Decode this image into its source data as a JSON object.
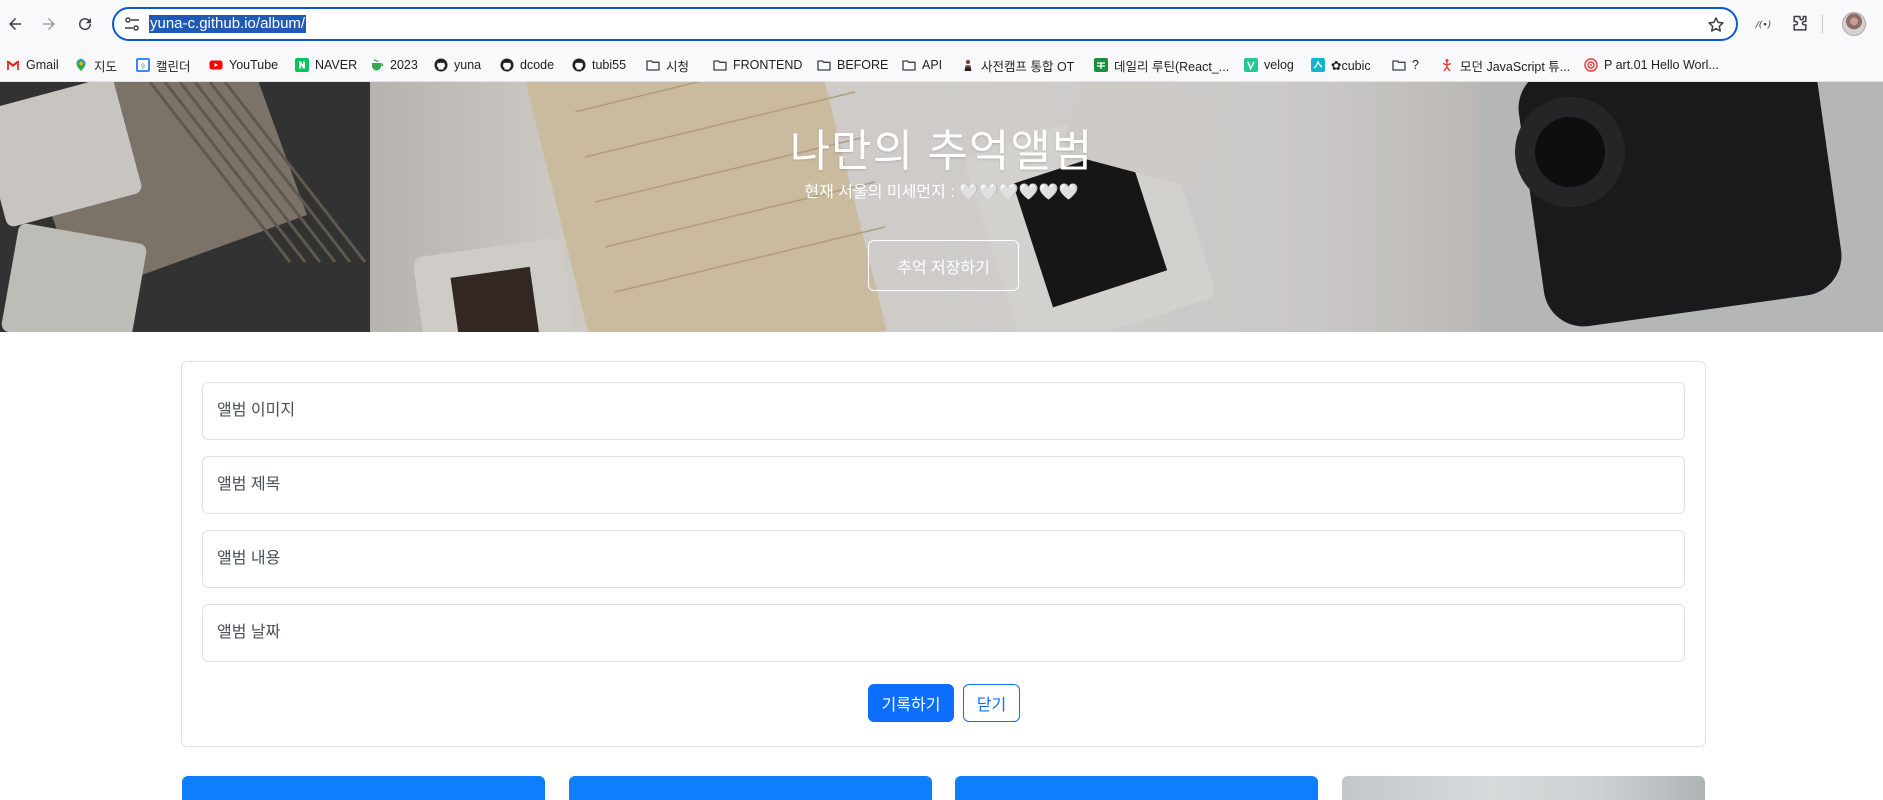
{
  "browser": {
    "url": "yuna-c.github.io/album/",
    "bookmarks": [
      {
        "label": "Gmail",
        "icon": "gmail-icon"
      },
      {
        "label": "지도",
        "icon": "maps-icon"
      },
      {
        "label": "캘린더",
        "icon": "calendar-icon"
      },
      {
        "label": "YouTube",
        "icon": "youtube-icon"
      },
      {
        "label": "NAVER",
        "icon": "naver-icon"
      },
      {
        "label": "2023",
        "icon": "cup-icon"
      },
      {
        "label": "yuna",
        "icon": "github-icon"
      },
      {
        "label": "dcode",
        "icon": "github-icon"
      },
      {
        "label": "tubi55",
        "icon": "github-icon"
      },
      {
        "label": "시청",
        "icon": "folder-icon"
      },
      {
        "label": "FRONTEND",
        "icon": "folder-icon"
      },
      {
        "label": "BEFORE",
        "icon": "folder-icon"
      },
      {
        "label": "API",
        "icon": "folder-icon"
      },
      {
        "label": "사전캠프 통합 OT",
        "icon": "notion-icon"
      },
      {
        "label": "데일리 루틴(React_...",
        "icon": "sheets-icon"
      },
      {
        "label": "velog",
        "icon": "velog-icon"
      },
      {
        "label": "✿cubic",
        "icon": "cubic-icon"
      },
      {
        "label": "?",
        "icon": "folder-icon"
      },
      {
        "label": "모던 JavaScript 튜...",
        "icon": "javascript-info-icon"
      },
      {
        "label": "P art.01 Hello Worl...",
        "icon": "target-icon"
      }
    ]
  },
  "hero": {
    "title": "나만의 추억앨범",
    "subtitle": "현재 서울의 미세먼지 : 🤍🤍🤍🤍🤍🤍",
    "button_label": "추억 저장하기"
  },
  "form": {
    "image_placeholder": "앨범 이미지",
    "title_placeholder": "앨범 제목",
    "content_placeholder": "앨범 내용",
    "date_placeholder": "앨범 날짜",
    "submit_label": "기록하기",
    "close_label": "닫기"
  },
  "colors": {
    "primary": "#0d6efd",
    "card_blue": "#0d7ffd",
    "url_highlight": "#1f5bb5"
  }
}
